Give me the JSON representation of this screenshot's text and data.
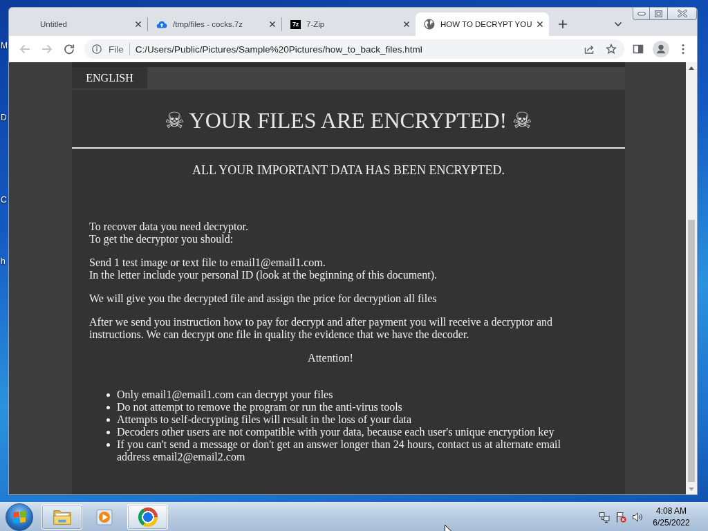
{
  "desktop": {
    "icon_labels": [
      "M",
      "D",
      "C",
      "h"
    ]
  },
  "browser": {
    "tabs": [
      {
        "kind": "blank",
        "title": "Untitled",
        "selected": false
      },
      {
        "kind": "cloud",
        "title": "/tmp/files - cocks.7z",
        "selected": false
      },
      {
        "kind": "archive",
        "icon_text": "7z",
        "title": "7-Zip",
        "selected": false
      },
      {
        "kind": "globe",
        "title": "HOW TO DECRYPT YOU",
        "selected": true
      }
    ],
    "toolbar": {
      "nav_buttons": [
        {
          "kind": "back",
          "disabled": true
        },
        {
          "kind": "forward",
          "disabled": true
        },
        {
          "kind": "reload",
          "disabled": false
        }
      ],
      "address": {
        "scheme_label": "File",
        "url": "C:/Users/Public/Pictures/Sample%20Pictures/how_to_back_files.html"
      }
    }
  },
  "page": {
    "language_tab": "ENGLISH",
    "heading": "☠ YOUR FILES ARE ENCRYPTED! ☠",
    "subheading": "ALL YOUR IMPORTANT DATA HAS BEEN ENCRYPTED.",
    "paragraphs": [
      {
        "lines": [
          "To recover data you need decryptor.",
          "To get the decryptor you should:"
        ]
      },
      {
        "lines": [
          "Send 1 test image or text file to email1@email1.com.",
          "In the letter include your personal ID (look at the beginning of this document)."
        ]
      },
      {
        "lines": [
          "We will give you the decrypted file and assign the price for decryption all files"
        ]
      },
      {
        "lines": [
          "After we send you instruction how to pay for decrypt and after payment you will receive a decryptor and instructions. We can decrypt one file in quality the evidence that we have the decoder."
        ]
      }
    ],
    "attention": "Attention!",
    "bullets": [
      "Only email1@email1.com can decrypt your files",
      "Do not attempt to remove the program or run the anti-virus tools",
      "Attempts to self-decrypting files will result in the loss of your data",
      "Decoders other users are not compatible with your data, because each user's unique encryption key",
      "If you can't send a message or don't get an answer longer than 24 hours, contact us at alternate email address email2@email2.com"
    ]
  },
  "taskbar": {
    "apps": [
      {
        "kind": "folder",
        "running": true,
        "selected": false
      },
      {
        "kind": "player",
        "running": false,
        "selected": false
      },
      {
        "kind": "browser",
        "running": true,
        "selected": true
      }
    ],
    "clock": {
      "time": "4:08 AM",
      "date": "6/25/2022"
    }
  }
}
